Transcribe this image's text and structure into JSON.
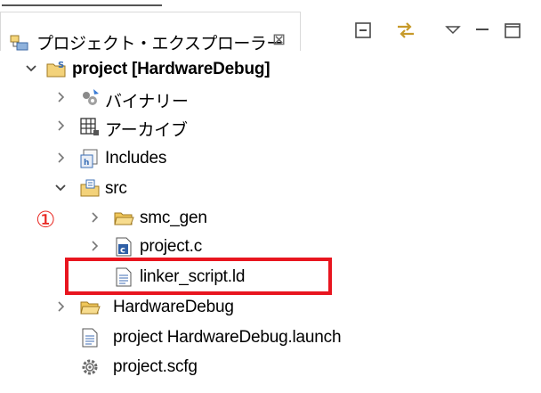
{
  "panel": {
    "title": "プロジェクト・エクスプローラー",
    "close_glyph": "⊠"
  },
  "toolbar": {
    "collapse_all_icon": "collapse-all-icon",
    "link_editor_icon": "link-with-editor-icon",
    "view_menu_icon": "view-menu-icon",
    "minimize_icon": "minimize-icon",
    "maximize_icon": "maximize-icon"
  },
  "tree": {
    "items": [
      {
        "label": "project [HardwareDebug]",
        "icon": "project-icon",
        "expanded": true
      },
      {
        "label": "バイナリー",
        "icon": "binaries-icon"
      },
      {
        "label": "アーカイブ",
        "icon": "archives-icon"
      },
      {
        "label": "Includes",
        "icon": "includes-icon"
      },
      {
        "label": "src",
        "icon": "source-folder-icon",
        "expanded": true
      },
      {
        "label": "smc_gen",
        "icon": "folder-icon"
      },
      {
        "label": "project.c",
        "icon": "c-file-icon"
      },
      {
        "label": "linker_script.ld",
        "icon": "text-file-icon"
      },
      {
        "label": "HardwareDebug",
        "icon": "folder-icon"
      },
      {
        "label": "project HardwareDebug.launch",
        "icon": "launch-file-icon"
      },
      {
        "label": "project.scfg",
        "icon": "config-file-icon"
      }
    ]
  },
  "annotation": {
    "marker": "①",
    "highlight_color": "#e8151f"
  }
}
